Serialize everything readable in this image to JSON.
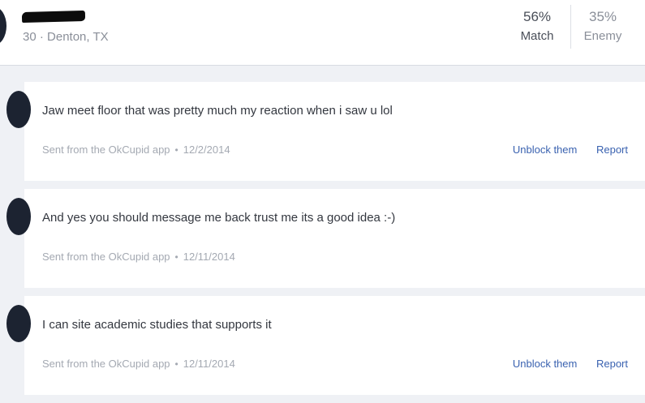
{
  "profile": {
    "subline": "30 · Denton, TX",
    "match": {
      "percent": "56%",
      "label": "Match"
    },
    "enemy": {
      "percent": "35%",
      "label": "Enemy"
    }
  },
  "messages": [
    {
      "text": "Jaw meet floor that was pretty much my reaction when i saw u lol",
      "source": "Sent from the OkCupid app",
      "date": "12/2/2014",
      "actions": {
        "unblock": "Unblock them",
        "report": "Report"
      }
    },
    {
      "text": "And yes you should message me back trust me its a good idea :-)",
      "source": "Sent from the OkCupid app",
      "date": "12/11/2014"
    },
    {
      "text": "I can site academic studies that supports it",
      "source": "Sent from the OkCupid app",
      "date": "12/11/2014",
      "actions": {
        "unblock": "Unblock them",
        "report": "Report"
      }
    }
  ],
  "meta_separator": "•",
  "colors": {
    "background": "#eff1f5",
    "card": "#ffffff",
    "link": "#3a62b0",
    "muted_text": "#a4a9b2",
    "body_text": "#33373f",
    "avatar": "#1c2331"
  }
}
